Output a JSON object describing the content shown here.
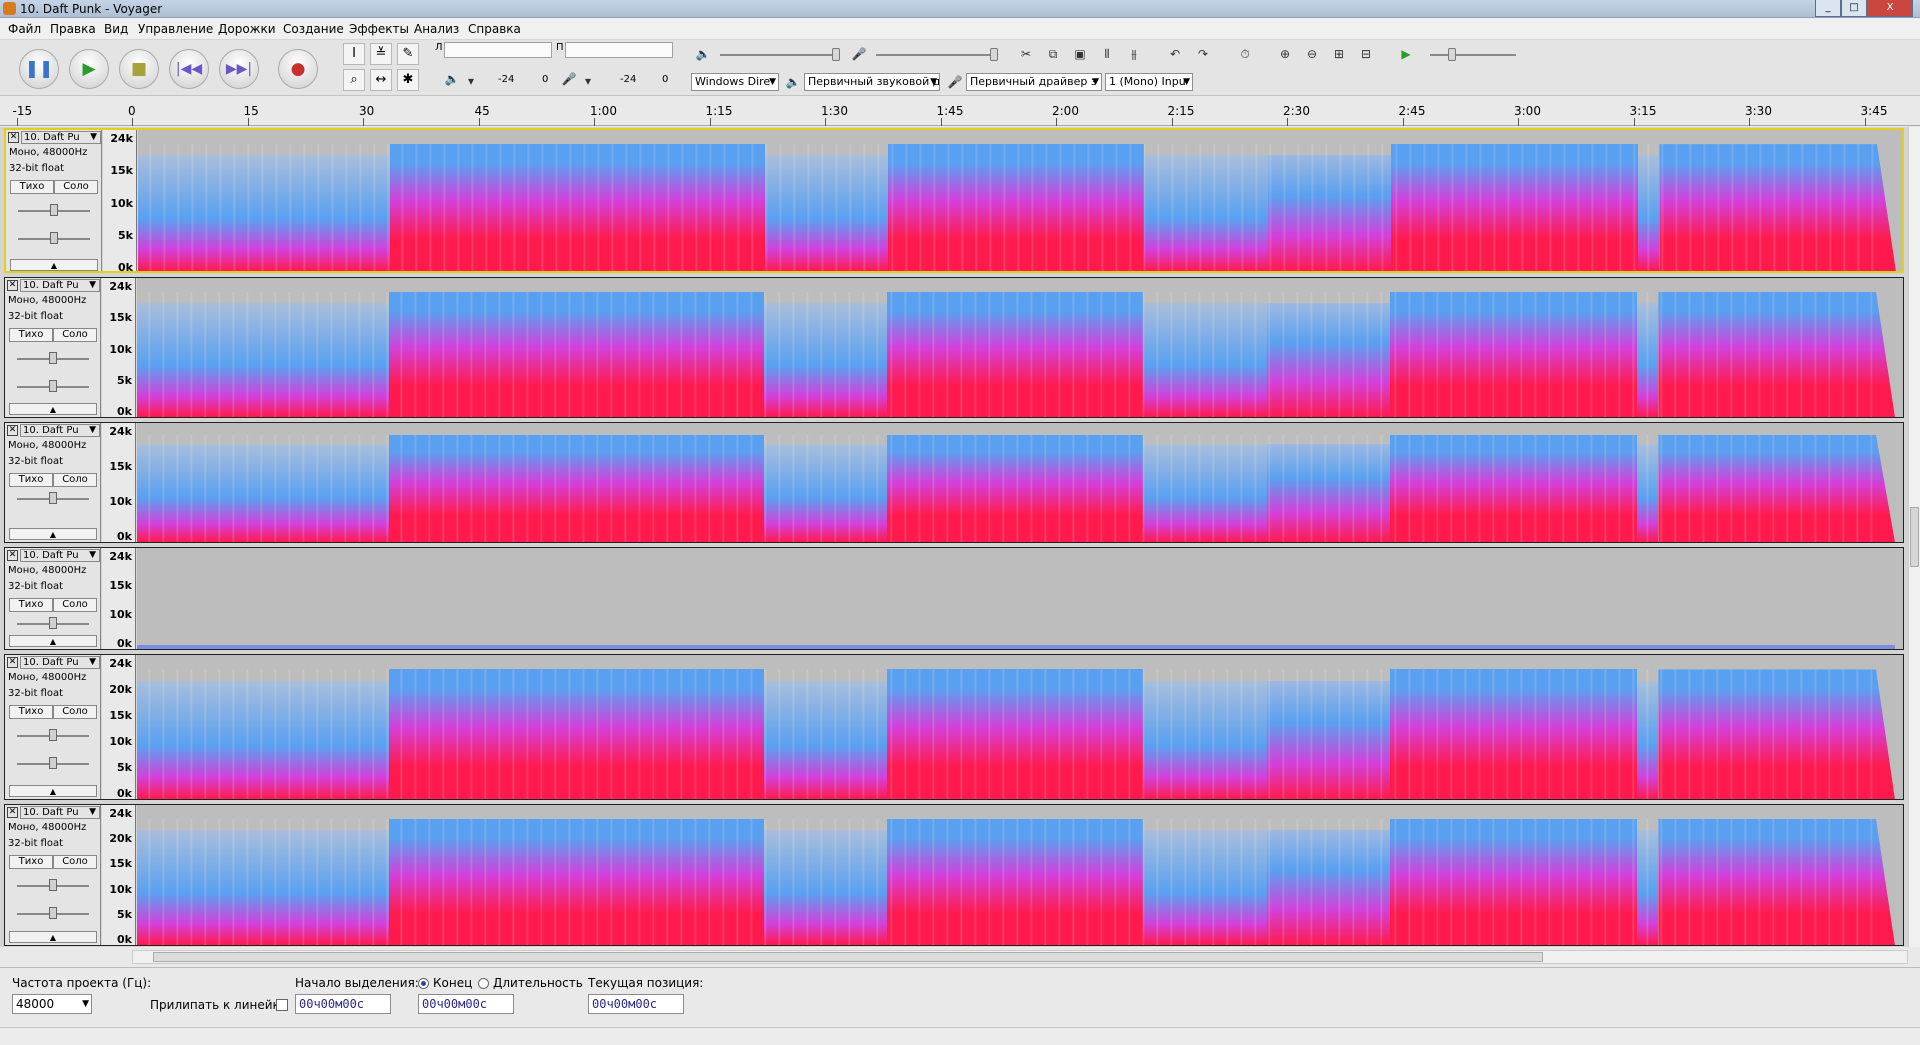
{
  "window": {
    "title": "10. Daft Punk - Voyager",
    "controls": [
      "_",
      "□",
      "X"
    ]
  },
  "menu": [
    "Файл",
    "Правка",
    "Вид",
    "Управление",
    "Дорожки",
    "Создание",
    "Эффекты",
    "Анализ",
    "Справка"
  ],
  "transport": {
    "pause": "pause-icon",
    "play": "play-icon",
    "stop": "stop-icon",
    "skip_start": "skip-start-icon",
    "skip_end": "skip-end-icon",
    "record": "record-icon"
  },
  "meters": {
    "rec_left": "Л",
    "rec_right": "П",
    "play_scale": [
      "-24",
      "0"
    ],
    "rec_scale": [
      "-24",
      "0"
    ]
  },
  "devices": {
    "host": "Windows Dire",
    "playback": "Первичный звуковой д",
    "recording": "Первичный драйвер з",
    "channels": "1 (Mono) Inpu"
  },
  "ruler": {
    "labels": [
      "-15",
      "0",
      "15",
      "30",
      "45",
      "1:00",
      "1:15",
      "1:30",
      "1:45",
      "2:00",
      "2:15",
      "2:30",
      "2:45",
      "3:00",
      "3:15",
      "3:30",
      "3:45"
    ]
  },
  "tracks": [
    {
      "name": "10. Daft Pu",
      "rate": "Моно, 48000Hz",
      "format": "32-bit float",
      "mute": "Тихо",
      "solo": "Соло",
      "scale": [
        "24k",
        "15k",
        "10k",
        "5k",
        "0k"
      ],
      "selected": true,
      "level": "full"
    },
    {
      "name": "10. Daft Pu",
      "rate": "Моно, 48000Hz",
      "format": "32-bit float",
      "mute": "Тихо",
      "solo": "Соло",
      "scale": [
        "24k",
        "15k",
        "10k",
        "5k",
        "0k"
      ],
      "selected": false,
      "level": "full"
    },
    {
      "name": "10. Daft Pu",
      "rate": "Моно, 48000Hz",
      "format": "32-bit float",
      "mute": "Тихо",
      "solo": "Соло",
      "scale": [
        "24k",
        "15k",
        "10k",
        "0k"
      ],
      "selected": false,
      "level": "full"
    },
    {
      "name": "10. Daft Pu",
      "rate": "Моно, 48000Hz",
      "format": "32-bit float",
      "mute": "Тихо",
      "solo": "Соло",
      "scale": [
        "24k",
        "15k",
        "10k",
        "0k"
      ],
      "selected": false,
      "level": "silent"
    },
    {
      "name": "10. Daft Pu",
      "rate": "Моно, 48000Hz",
      "format": "32-bit float",
      "mute": "Тихо",
      "solo": "Соло",
      "scale": [
        "24k",
        "20k",
        "15k",
        "10k",
        "5k",
        "0k"
      ],
      "selected": false,
      "level": "full"
    },
    {
      "name": "10. Daft Pu",
      "rate": "Моно, 48000Hz",
      "format": "32-bit float",
      "mute": "Тихо",
      "solo": "Соло",
      "scale": [
        "24k",
        "20k",
        "15k",
        "10k",
        "5k",
        "0k"
      ],
      "selected": false,
      "level": "full"
    }
  ],
  "bottom": {
    "rate_label": "Частота проекта (Гц):",
    "rate_value": "48000",
    "snap_label": "Прилипать к линейке",
    "sel_start_label": "Начало выделения:",
    "end_label": "Конец",
    "length_label": "Длительность",
    "pos_label": "Текущая позиция:",
    "sel_start": "00ч00м00с",
    "sel_end": "00ч00м00с",
    "position": "00ч00м00с"
  },
  "colors": {
    "spectrum_high": "#ff1a4d",
    "spectrum_mid": "#d43fd9",
    "spectrum_low": "#5aa0f0",
    "background": "#bdbdbd",
    "selected_border": "#e0cf1c"
  }
}
